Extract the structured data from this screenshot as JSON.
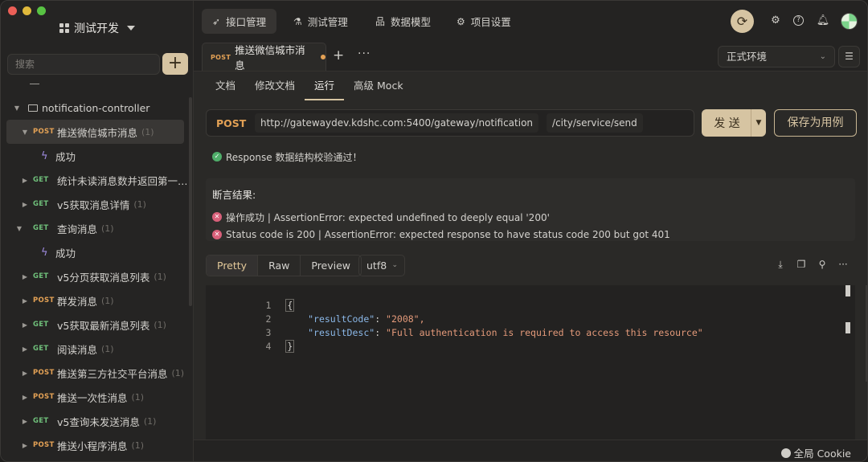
{
  "sidebar": {
    "project_name": "测试开发",
    "search_placeholder": "搜索",
    "add_label": "+",
    "folder": "notification-controller",
    "items": [
      {
        "method": "POST",
        "label": "推送微信城市消息",
        "count": "(1)",
        "expanded": true,
        "active": true
      },
      {
        "case": "成功"
      },
      {
        "method": "GET",
        "label": "统计未读消息数并返回第一…",
        "count": ""
      },
      {
        "method": "GET",
        "label": "v5获取消息详情",
        "count": "(1)"
      },
      {
        "method": "GET",
        "label": "查询消息",
        "count": "(1)",
        "expanded": true
      },
      {
        "case": "成功"
      },
      {
        "method": "GET",
        "label": "v5分页获取消息列表",
        "count": "(1)"
      },
      {
        "method": "POST",
        "label": "群发消息",
        "count": "(1)"
      },
      {
        "method": "GET",
        "label": "v5获取最新消息列表",
        "count": "(1)"
      },
      {
        "method": "GET",
        "label": "阅读消息",
        "count": "(1)"
      },
      {
        "method": "POST",
        "label": "推送第三方社交平台消息",
        "count": "(1)"
      },
      {
        "method": "POST",
        "label": "推送一次性消息",
        "count": "(1)"
      },
      {
        "method": "GET",
        "label": "v5查询未发送消息",
        "count": "(1)"
      },
      {
        "method": "POST",
        "label": "推送小程序消息",
        "count": "(1)"
      }
    ]
  },
  "topnav": {
    "tabs": [
      {
        "label": "接口管理",
        "icon": "rocket-icon",
        "active": true
      },
      {
        "label": "测试管理",
        "icon": "flask-icon"
      },
      {
        "label": "数据模型",
        "icon": "model-icon"
      },
      {
        "label": "项目设置",
        "icon": "gear-icon"
      }
    ]
  },
  "doctab": {
    "method": "POST",
    "title": "推送微信城市消息",
    "environment": "正式环境"
  },
  "subtabs": [
    "文档",
    "修改文档",
    "运行",
    "高级 Mock"
  ],
  "request": {
    "method": "POST",
    "base_url": "http://gatewaydev.kdshc.com:5400/gateway/notification",
    "path": "/city/service/send",
    "send_label": "发 送",
    "save_case_label": "保存为用例"
  },
  "schema_check": "Response 数据结构校验通过！",
  "assertions": {
    "title": "断言结果:",
    "items": [
      "操作成功 | AssertionError: expected undefined to deeply equal '200'",
      "Status code is 200 | AssertionError: expected response to have status code 200 but got 401"
    ]
  },
  "response": {
    "views": [
      "Pretty",
      "Raw",
      "Preview"
    ],
    "encoding": "utf8",
    "lines": [
      {
        "n": "1",
        "text": "{"
      },
      {
        "n": "2",
        "key": "\"resultCode\"",
        "value": "\"2008\","
      },
      {
        "n": "3",
        "key": "\"resultDesc\"",
        "value": "\"Full authentication is required to access this resource\""
      },
      {
        "n": "4",
        "text": "}"
      }
    ]
  },
  "footer": {
    "cookie": "全局 Cookie"
  },
  "colors": {
    "accent": "#d6c4a2",
    "post": "#e3a155",
    "get": "#6fbf7a",
    "ok": "#4fae6a",
    "error": "#d9607a"
  }
}
